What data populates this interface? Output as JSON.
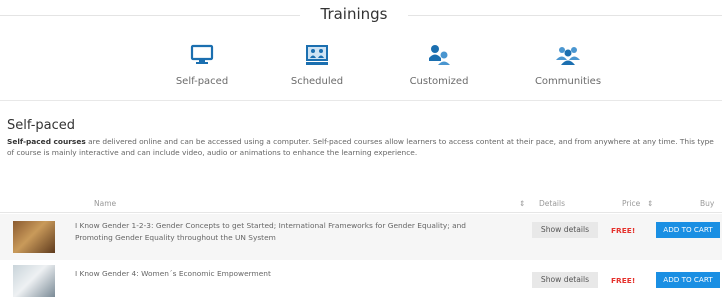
{
  "header": {
    "title": "Trainings"
  },
  "categories": [
    {
      "label": "Self-paced",
      "icon": "monitor-icon"
    },
    {
      "label": "Scheduled",
      "icon": "classroom-icon"
    },
    {
      "label": "Customized",
      "icon": "people-customize-icon"
    },
    {
      "label": "Communities",
      "icon": "community-icon"
    }
  ],
  "section": {
    "title": "Self-paced",
    "desc_bold": "Self-paced courses",
    "desc_rest": " are delivered online and can be accessed using a computer. Self-paced courses allow learners to access content at their pace, and from anywhere at any time. This type of course is mainly interactive and can include video, audio or animations to enhance the learning experience."
  },
  "table": {
    "headers": {
      "name": "Name",
      "sort_icon": "sort-icon",
      "details": "Details",
      "price": "Price",
      "buy": "Buy"
    },
    "rows": [
      {
        "name": "I Know Gender 1-2-3: Gender Concepts to get Started; International Frameworks for Gender Equality; and Promoting Gender Equality throughout the UN System",
        "details": "Show details",
        "price": "FREE!",
        "cart": "ADD TO CART"
      },
      {
        "name": "I Know Gender 4: Women´s Economic Empowerment",
        "details": "Show details",
        "price": "FREE!",
        "cart": "ADD TO CART"
      }
    ]
  },
  "colors": {
    "accent": "#1a8fe3",
    "icon": "#1b6fb0",
    "price": "#e5322d"
  }
}
